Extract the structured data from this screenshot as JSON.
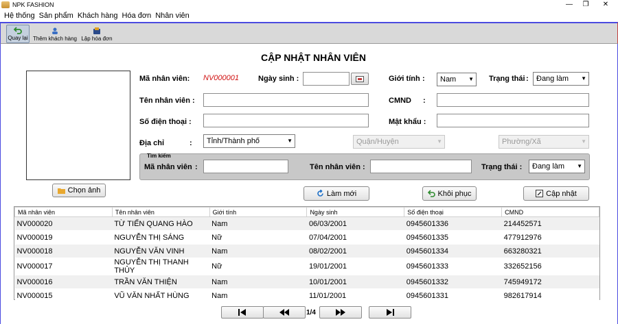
{
  "window": {
    "title": "NPK FASHION",
    "minimize": "—",
    "restore": "❐",
    "close": "✕"
  },
  "menu": [
    "Hệ thống",
    "Sản phẩm",
    "Khách hàng",
    "Hóa đơn",
    "Nhân viên"
  ],
  "toolbar": {
    "back": "Quay lại",
    "add_customer": "Thêm khách hàng",
    "create_invoice": "Lập hóa đơn"
  },
  "form": {
    "title": "CẬP NHẬT NHÂN VIÊN",
    "employee_id_label": "Mã nhân viên:",
    "employee_id_value": "NV000001",
    "dob_label": "Ngày sinh :",
    "dob_value": "",
    "gender_label": "Giới tính",
    "gender_value": "Nam",
    "status_label": "Trạng thái",
    "status_value": "Đang làm",
    "name_label": "Tên nhân viên :",
    "name_value": "",
    "id_card_label": "CMND",
    "id_card_colon": ":",
    "id_card_value": "",
    "phone_label": "Số điện thoại",
    "phone_colon": ":",
    "phone_value": "",
    "password_label": "Mật khẩu :",
    "password_value": "",
    "address_label": "Địa chỉ",
    "address_colon": ":",
    "province_value": "Tỉnh/Thành phố",
    "district_value": "Quận/Huyện",
    "ward_value": "Phường/Xã",
    "gender_colon": ":",
    "status_colon": ":",
    "choose_photo": "Chọn ảnh"
  },
  "search": {
    "legend": "Tìm kiếm",
    "id_label": "Mã nhân viên",
    "id_colon": ":",
    "id_value": "",
    "name_label": "Tên nhân viên :",
    "name_value": "",
    "status_label": "Trạng thái :",
    "status_value": "Đang làm"
  },
  "actions": {
    "refresh": "Làm mới",
    "restore": "Khôi phục",
    "update": "Cập nhật"
  },
  "table": {
    "columns": [
      "Mã nhân viên",
      "Tên nhân viên",
      "Giới tính",
      "Ngày sinh",
      "Số điện thoại",
      "CMND"
    ],
    "rows": [
      [
        "NV000020",
        "TỪ TIẾN QUANG HÀO",
        "Nam",
        "06/03/2001",
        "0945601336",
        "214452571"
      ],
      [
        "NV000019",
        "NGUYỄN THỊ SÁNG",
        "Nữ",
        "07/04/2001",
        "0945601335",
        "477912976"
      ],
      [
        "NV000018",
        "NGUYỄN VĂN VINH",
        "Nam",
        "08/02/2001",
        "0945601334",
        "663280321"
      ],
      [
        "NV000017",
        "NGUYỄN THỊ THANH THỦY",
        "Nữ",
        "19/01/2001",
        "0945601333",
        "332652156"
      ],
      [
        "NV000016",
        "TRẦN VĂN THIỆN",
        "Nam",
        "10/01/2001",
        "0945601332",
        "745949172"
      ],
      [
        "NV000015",
        "VŨ VĂN NHẤT HÙNG",
        "Nam",
        "11/01/2001",
        "0945601331",
        "982617914"
      ]
    ]
  },
  "pager": {
    "text": "1/4"
  },
  "colors": {
    "accent_border": "#4a4ae0",
    "error_red": "#d01010",
    "toolbar_bg": "#d9d9d9"
  }
}
